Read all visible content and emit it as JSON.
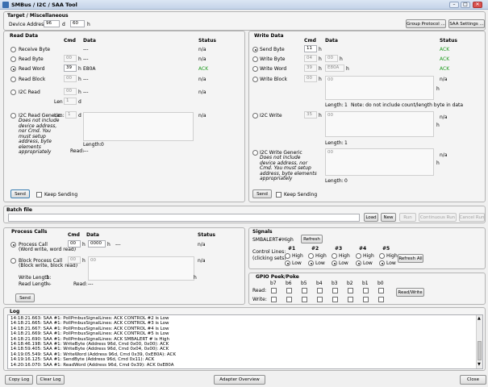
{
  "window": {
    "title": "SMBus / I2C / SAA Tool",
    "min": "–",
    "max": "□",
    "close": "✕"
  },
  "target": {
    "title": "Target / Miscellaneous",
    "addr_label": "Device Address:",
    "addr_dec": "96",
    "d": "d",
    "addr_hex": "60",
    "h": "h",
    "group_protocol": "Group Protocol ...",
    "saa_settings": "SAA Settings ..."
  },
  "read": {
    "title": "Read Data",
    "cmd_hdr": "Cmd",
    "data_hdr": "Data",
    "status_hdr": "Status",
    "receive_byte": "Receive Byte",
    "receive_data": "---",
    "receive_status": "n/a",
    "read_byte": "Read Byte",
    "rb_cmd": "00",
    "rb_data": "---",
    "rb_status": "n/a",
    "read_word": "Read Word",
    "rw_cmd": "39",
    "rw_data": "E80A",
    "rw_status": "ACK",
    "read_block": "Read Block",
    "rbl_cmd": "00",
    "rbl_data": "---",
    "rbl_status": "n/a",
    "i2c_read": "I2C Read",
    "i2c_cmd": "00",
    "i2c_data": "---",
    "i2c_status": "n/a",
    "len_label": "Len",
    "len_val": "1",
    "len_unit": "d",
    "generic": "I2C Read Generic:",
    "generic_note": "Does not include device address, nor Cmd. You must setup address, byte elements appropriately",
    "generic_len_label": "Len:",
    "generic_len": "1",
    "generic_status": "n/a",
    "length_label": "Length:",
    "length_val": "0",
    "read_label": "Read:",
    "read_val": "---",
    "send": "Send",
    "keep_sending": "Keep Sending"
  },
  "write": {
    "title": "Write Data",
    "cmd_hdr": "Cmd",
    "data_hdr": "Data",
    "status_hdr": "Status",
    "send_byte": "Send Byte",
    "sb_cmd": "11",
    "sb_status": "ACK",
    "write_byte": "Write Byte",
    "wb_cmd": "04",
    "wb_data": "00",
    "wb_status": "ACK",
    "write_word": "Write Word",
    "ww_cmd": "39",
    "ww_data": "E80A",
    "ww_status": "ACK",
    "write_block": "Write Block",
    "wbl_cmd": "00",
    "wbl_data": "00",
    "wbl_status": "n/a",
    "block_length_label": "Length:",
    "block_length": "1",
    "block_note": "Note: do not include count/length byte in data",
    "i2c_write": "I2C Write",
    "i2cw_cmd": "35",
    "i2cw_data": "00",
    "i2cw_status": "n/a",
    "i2cw_length_label": "Length:",
    "i2cw_length": "1",
    "generic": "I2C Write Generic",
    "generic_note": "Does not include device address, nor Cmd. You must setup address, byte elements appropriately",
    "generic_data": "00",
    "generic_status": "n/a",
    "generic_length_label": "Length:",
    "generic_length": "0",
    "send": "Send",
    "keep_sending": "Keep Sending"
  },
  "batch": {
    "title": "Batch file",
    "load": "Load",
    "new": "New",
    "run": "Run",
    "continuous_run": "Continuous Run",
    "cancel_run": "Cancel Run"
  },
  "process": {
    "title": "Process Calls",
    "cmd_hdr": "Cmd",
    "data_hdr": "Data",
    "status_hdr": "Status",
    "process_call": "Process Call",
    "process_call_sub": "(Word write, word read)",
    "pc_cmd": "00",
    "pc_data": "0000",
    "pc_result": "---",
    "pc_status": "n/a",
    "block_call": "Block Process Call",
    "block_call_sub": "(Block write, block read)",
    "bc_cmd": "00",
    "bc_data": "00",
    "bc_status": "n/a",
    "write_length_label": "Write Length:",
    "write_length": "1",
    "read_length_label": "Read Length:",
    "read_length": "---",
    "read_label": "Read:",
    "read_val": "---",
    "send": "Send"
  },
  "signals": {
    "title": "Signals",
    "smbalert_label": "SMBALERT#:",
    "smbalert_val": "High",
    "refresh": "Refresh",
    "control_lines": "Control Lines:",
    "clicking_sets": "(clicking sets)",
    "lines": [
      "#1",
      "#2",
      "#3",
      "#4",
      "#5"
    ],
    "high": "High",
    "low": "Low",
    "refresh_all": "Refresh All"
  },
  "gpio": {
    "title": "GPIO Peek/Poke",
    "bits": [
      "b7",
      "b6",
      "b5",
      "b4",
      "b3",
      "b2",
      "b1",
      "b0"
    ],
    "read_label": "Read:",
    "write_label": "Write:",
    "read_write": "Read/Write"
  },
  "log": {
    "title": "Log",
    "lines": [
      "14:18:21.663: SAA #1: PollPmbusSignalLines: ACK CONTROL #2 is Low",
      "14:18:21.665: SAA #1: PollPmbusSignalLines: ACK CONTROL #3 is Low",
      "14:18:21.667: SAA #1: PollPmbusSignalLines: ACK CONTROL #4 is Low",
      "14:18:21.669: SAA #1: PollPmbusSignalLines: ACK CONTROL #5 is Low",
      "14:18:21.690: SAA #1: PollPmbusSignalLines: ACK SMBALERT # is High",
      "14:18:46.198: SAA #1: WriteByte (Address 96d, Cmd 0x00, 0x00): ACK",
      "14:18:59.405: SAA #1: WriteByte (Address 96d, Cmd 0x04, 0x00): ACK",
      "14:19:05.549: SAA #1: WriteWord (Address 96d, Cmd 0x39, 0xE80A): ACK",
      "14:19:16.125: SAA #1: SendByte (Address 96d, Cmd 0x11): ACK",
      "14:20:16.070: SAA #1: ReadWord (Address 96d, Cmd 0x39): ACK 0xE80A"
    ]
  },
  "bottom": {
    "copy_log": "Copy Log",
    "clear_log": "Clear Log",
    "adapter_overview": "Adapter Overview",
    "close": "Close"
  }
}
